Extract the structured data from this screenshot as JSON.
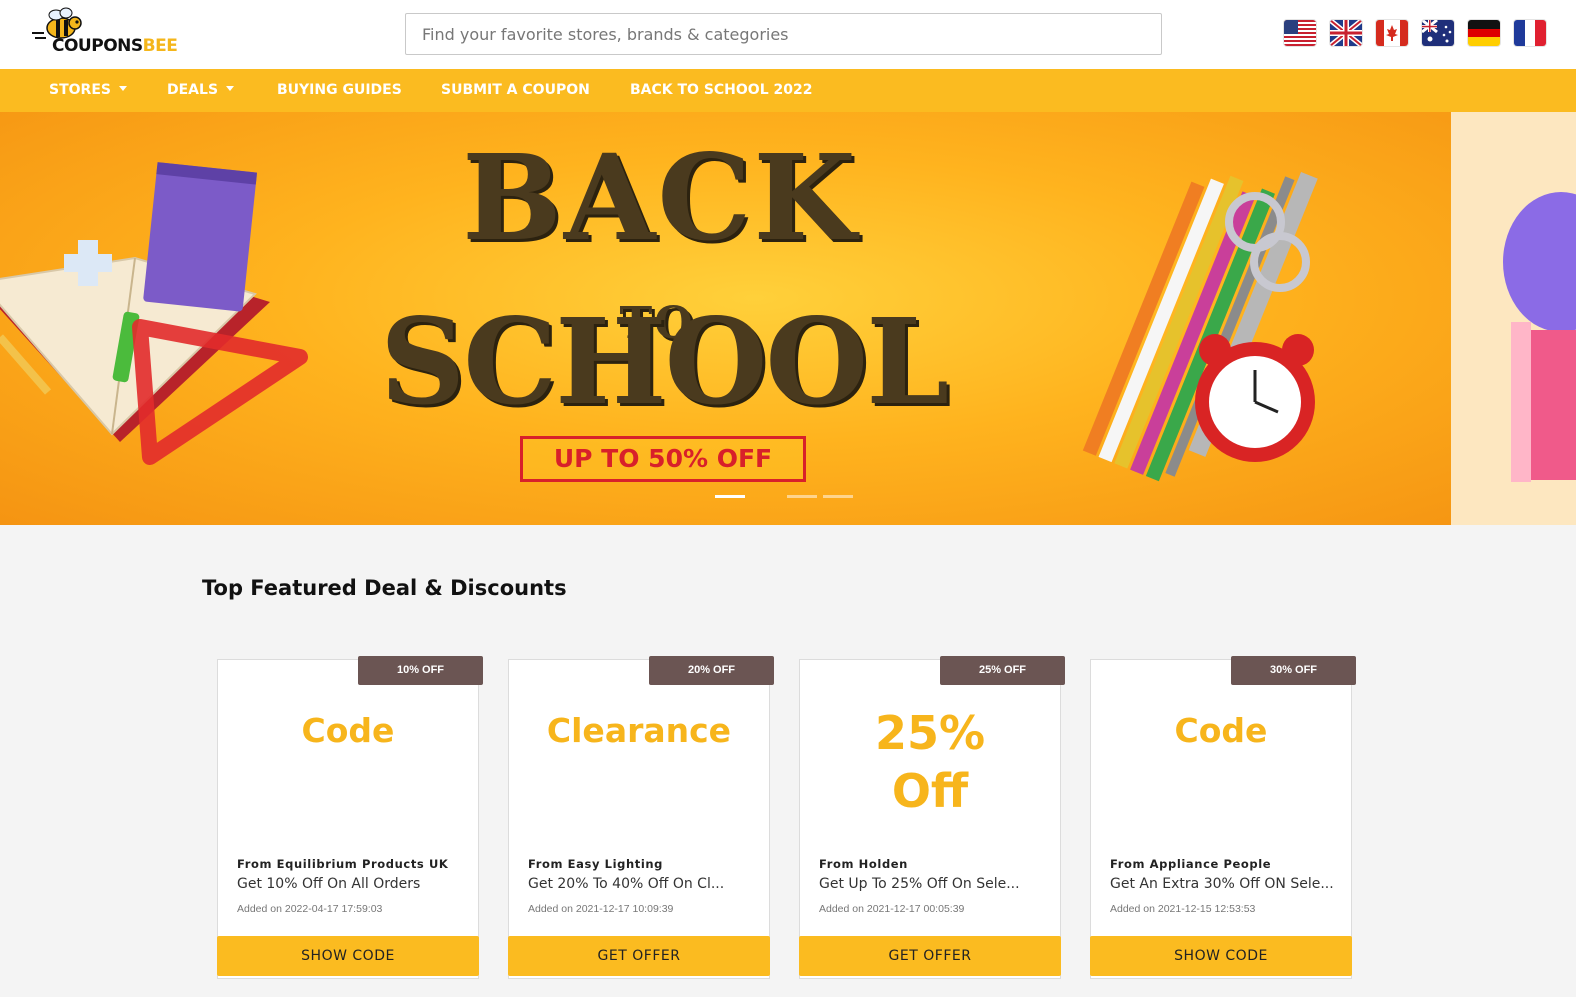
{
  "brand": {
    "logo_main": "COUPONS",
    "logo_accent": "BEE"
  },
  "search": {
    "placeholder": "Find your favorite stores, brands & categories"
  },
  "flags": [
    "us-flag-icon",
    "uk-flag-icon",
    "canada-flag-icon",
    "australia-flag-icon",
    "germany-flag-icon",
    "france-flag-icon"
  ],
  "nav": {
    "items": [
      {
        "label": "STORES",
        "dropdown": true
      },
      {
        "label": "DEALS",
        "dropdown": true
      },
      {
        "label": "BUYING GUIDES",
        "dropdown": false
      },
      {
        "label": "SUBMIT A COUPON",
        "dropdown": false
      },
      {
        "label": "BACK TO SCHOOL 2022",
        "dropdown": false
      }
    ]
  },
  "hero": {
    "line1": "BACK",
    "line2": "TO",
    "line3": "SCHOOL",
    "promo": "UP TO 50% OFF",
    "slides": 4,
    "active_slide": 1
  },
  "section": {
    "title": "Top Featured Deal & Discounts"
  },
  "deals": [
    {
      "badge": "10% OFF",
      "headline": "Code",
      "from": "From Equilibrium Products UK",
      "description": "Get 10% Off On All Orders",
      "added": "Added on 2022-04-17 17:59:03",
      "cta": "SHOW CODE"
    },
    {
      "badge": "20% OFF",
      "headline": "Clearance",
      "from": "From Easy Lighting",
      "description": "Get 20% To 40% Off On Cl...",
      "added": "Added on 2021-12-17 10:09:39",
      "cta": "GET OFFER"
    },
    {
      "badge": "25% OFF",
      "headline": "25% Off",
      "from": "From Holden",
      "description": "Get Up To 25% Off On Sele...",
      "added": "Added on 2021-12-17 00:05:39",
      "cta": "GET OFFER"
    },
    {
      "badge": "30% OFF",
      "headline": "Code",
      "from": "From Appliance People",
      "description": "Get An Extra 30% Off ON Sele...",
      "added": "Added on 2021-12-15 12:53:53",
      "cta": "SHOW CODE"
    }
  ],
  "colors": {
    "accent": "#fbbb20",
    "headline": "#f7b51c",
    "badge": "#6b5553",
    "promo_red": "#d8202a"
  }
}
